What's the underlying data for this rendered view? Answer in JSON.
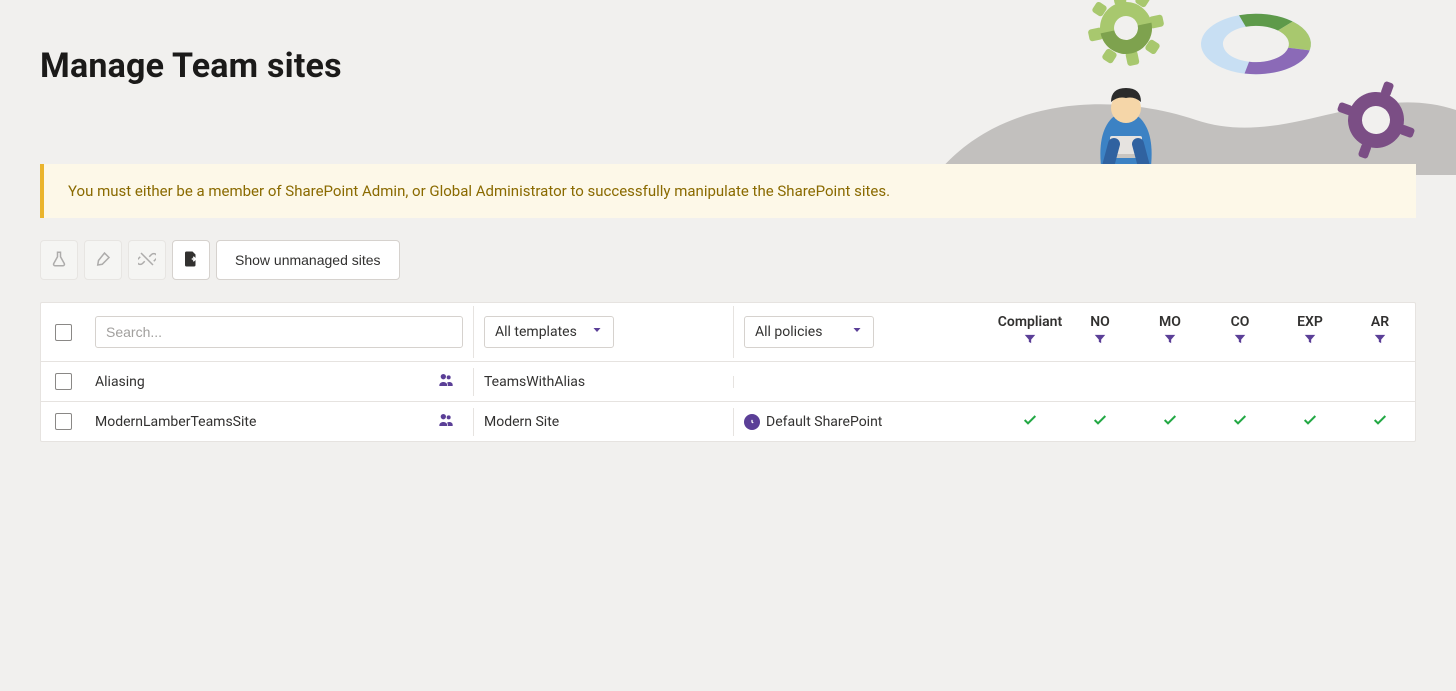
{
  "page_title": "Manage Team sites",
  "alert": "You must either be a member of SharePoint Admin, or Global Administrator to successfully manipulate the SharePoint sites.",
  "toolbar": {
    "show_unmanaged_label": "Show unmanaged sites"
  },
  "filters": {
    "search_placeholder": "Search...",
    "template_selected": "All templates",
    "policy_selected": "All policies"
  },
  "columns": {
    "compliant": "Compliant",
    "no": "NO",
    "mo": "MO",
    "co": "CO",
    "exp": "EXP",
    "ar": "AR"
  },
  "rows": [
    {
      "name": "Aliasing",
      "has_group": true,
      "template": "TeamsWithAlias",
      "policy": "",
      "status": {
        "compliant": null,
        "no": null,
        "mo": null,
        "co": null,
        "exp": null,
        "ar": null
      }
    },
    {
      "name": "ModernLamberTeamsSite",
      "has_group": true,
      "template": "Modern Site",
      "policy": "Default SharePoint",
      "status": {
        "compliant": "ok",
        "no": "ok",
        "mo": "ok",
        "co": "ok",
        "exp": "ok",
        "ar": "ok"
      }
    }
  ]
}
